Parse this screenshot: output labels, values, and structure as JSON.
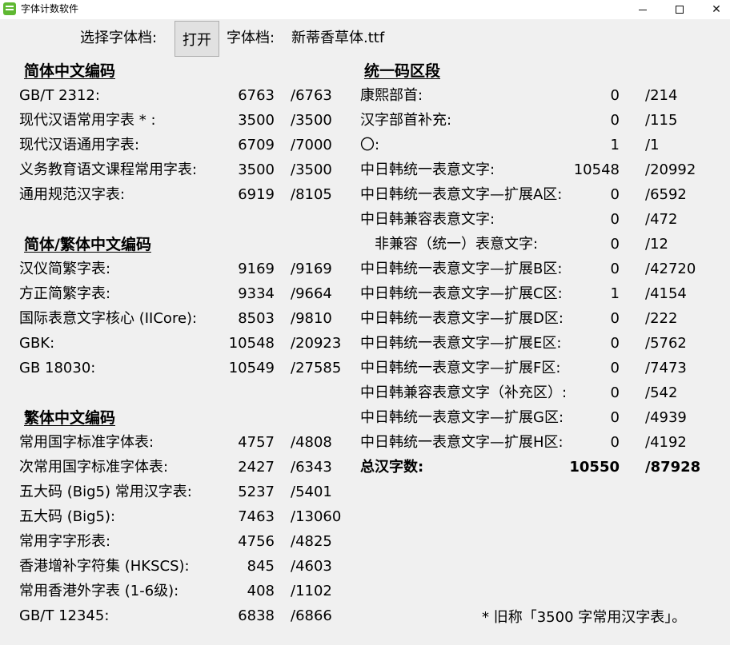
{
  "window": {
    "title": "字体计数软件",
    "minimize": "—",
    "maximize": "□",
    "close": "✕"
  },
  "toolbar": {
    "select_label": "选择字体档:",
    "open_button": "打开",
    "font_label": "字体档:",
    "font_file": "新蒂香草体.ttf"
  },
  "simplified": {
    "title": "简体中文编码",
    "rows": [
      {
        "label": "GB/T 2312:",
        "count": "6763",
        "total": "/6763"
      },
      {
        "label": "现代汉语常用字表 * :",
        "count": "3500",
        "total": "/3500"
      },
      {
        "label": "现代汉语通用字表:",
        "count": "6709",
        "total": "/7000"
      },
      {
        "label": "义务教育语文课程常用字表:",
        "count": "3500",
        "total": "/3500"
      },
      {
        "label": "通用规范汉字表:",
        "count": "6919",
        "total": "/8105"
      }
    ]
  },
  "simp_trad": {
    "title": "简体/繁体中文编码",
    "rows": [
      {
        "label": "汉仪简繁字表:",
        "count": "9169",
        "total": "/9169"
      },
      {
        "label": "方正简繁字表:",
        "count": "9334",
        "total": "/9664"
      },
      {
        "label": "国际表意文字核心 (IICore):",
        "count": "8503",
        "total": "/9810"
      },
      {
        "label": "GBK:",
        "count": "10548",
        "total": "/20923"
      },
      {
        "label": "GB 18030:",
        "count": "10549",
        "total": "/27585"
      }
    ]
  },
  "traditional": {
    "title": "繁体中文编码",
    "rows": [
      {
        "label": "常用国字标准字体表:",
        "count": "4757",
        "total": "/4808"
      },
      {
        "label": "次常用国字标准字体表:",
        "count": "2427",
        "total": "/6343"
      },
      {
        "label": "五大码 (Big5) 常用汉字表:",
        "count": "5237",
        "total": "/5401"
      },
      {
        "label": "五大码 (Big5):",
        "count": "7463",
        "total": "/13060"
      },
      {
        "label": "常用字字形表:",
        "count": "4756",
        "total": "/4825"
      },
      {
        "label": "香港增补字符集 (HKSCS):",
        "count": "845",
        "total": "/4603"
      },
      {
        "label": "常用香港外字表 (1-6级):",
        "count": "408",
        "total": "/1102"
      },
      {
        "label": "GB/T 12345:",
        "count": "6838",
        "total": "/6866"
      }
    ]
  },
  "unicode": {
    "title": "统一码区段",
    "rows": [
      {
        "label": "康熙部首:",
        "count": "0",
        "total": "/214"
      },
      {
        "label": "汉字部首补充:",
        "count": "0",
        "total": "/115"
      },
      {
        "label": "〇:",
        "count": "1",
        "total": "/1"
      },
      {
        "label": "中日韩统一表意文字:",
        "count": "10548",
        "total": "/20992"
      },
      {
        "label": "中日韩统一表意文字—扩展A区:",
        "count": "0",
        "total": "/6592"
      },
      {
        "label": "中日韩兼容表意文字:",
        "count": "0",
        "total": "/472"
      },
      {
        "label": "非兼容（统一）表意文字:",
        "count": "0",
        "total": "/12"
      },
      {
        "label": "中日韩统一表意文字—扩展B区:",
        "count": "0",
        "total": "/42720"
      },
      {
        "label": "中日韩统一表意文字—扩展C区:",
        "count": "1",
        "total": "/4154"
      },
      {
        "label": "中日韩统一表意文字—扩展D区:",
        "count": "0",
        "total": "/222"
      },
      {
        "label": "中日韩统一表意文字—扩展E区:",
        "count": "0",
        "total": "/5762"
      },
      {
        "label": "中日韩统一表意文字—扩展F区:",
        "count": "0",
        "total": "/7473"
      },
      {
        "label": "中日韩兼容表意文字（补充区）:",
        "count": "0",
        "total": "/542"
      },
      {
        "label": "中日韩统一表意文字—扩展G区:",
        "count": "0",
        "total": "/4939"
      },
      {
        "label": "中日韩统一表意文字—扩展H区:",
        "count": "0",
        "total": "/4192"
      }
    ],
    "total": {
      "label": "总汉字数:",
      "count": "10550",
      "total": "/87928"
    }
  },
  "footnote": "* 旧称「3500 字常用汉字表」。"
}
